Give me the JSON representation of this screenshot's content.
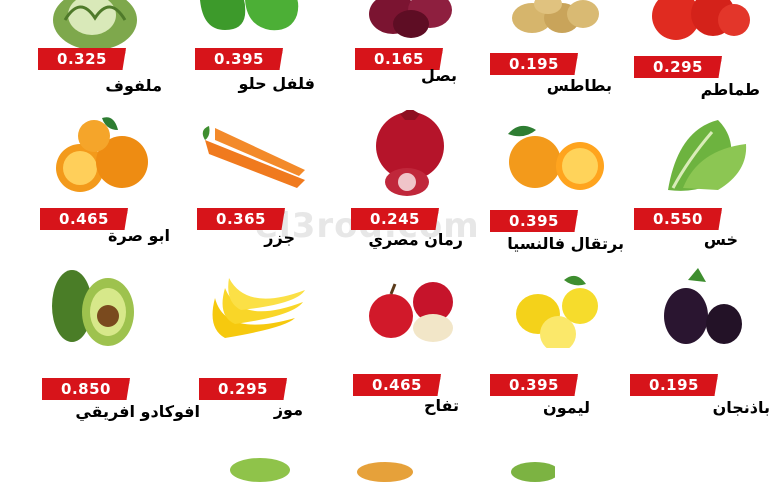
{
  "watermark": "el3rod.com",
  "products": [
    {
      "id": "cabbage",
      "name": "ملفوف",
      "price": "0.325",
      "icon": "cabbage-icon"
    },
    {
      "id": "bell-pepper",
      "name": "فلفل حلو",
      "price": "0.395",
      "icon": "bell-pepper-icon"
    },
    {
      "id": "onion",
      "name": "بصل",
      "price": "0.165",
      "icon": "onion-icon"
    },
    {
      "id": "potato",
      "name": "بطاطس",
      "price": "0.195",
      "icon": "potato-icon"
    },
    {
      "id": "tomato",
      "name": "طماطم",
      "price": "0.295",
      "icon": "tomato-icon"
    },
    {
      "id": "mandarin",
      "name": "ابو صرة",
      "price": "0.465",
      "icon": "orange-icon"
    },
    {
      "id": "carrot",
      "name": "جزر",
      "price": "0.365",
      "icon": "carrot-icon"
    },
    {
      "id": "pomegranate",
      "name": "رمان مصري",
      "price": "0.245",
      "icon": "pomegranate-icon"
    },
    {
      "id": "valencia-orange",
      "name": "برتقال فالنسيا",
      "price": "0.395",
      "icon": "orange-slice-icon"
    },
    {
      "id": "lettuce",
      "name": "خس",
      "price": "0.550",
      "icon": "lettuce-icon"
    },
    {
      "id": "avocado",
      "name": "افوكادو افريقي",
      "price": "0.850",
      "icon": "avocado-icon"
    },
    {
      "id": "banana",
      "name": "موز",
      "price": "0.295",
      "icon": "banana-icon"
    },
    {
      "id": "apple",
      "name": "تفاح",
      "price": "0.465",
      "icon": "apple-icon"
    },
    {
      "id": "lemon",
      "name": "ليمون",
      "price": "0.395",
      "icon": "lemon-icon"
    },
    {
      "id": "eggplant",
      "name": "باذنجان",
      "price": "0.195",
      "icon": "eggplant-icon"
    }
  ]
}
